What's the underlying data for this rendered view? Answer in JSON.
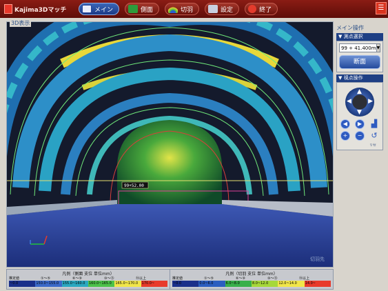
{
  "app": {
    "brand": "Kajima3Dマッチ",
    "brand_icon": "kajima-logo-icon",
    "accent_color": "#7a1610",
    "active_color": "#2a56a8"
  },
  "nav": {
    "main_label": "メイン",
    "side_label": "側面",
    "face_label": "切羽",
    "settings_label": "設定",
    "exit_label": "終了"
  },
  "view": {
    "caption": "3D表示",
    "station_tag": "99+52.00",
    "site_mark": "切羽先"
  },
  "side_panel": {
    "caption": "メイン操作",
    "section_select_title": "▼ 測点選択",
    "station_value": "99 + 41.400m",
    "cut_button_label": "断面",
    "section_view_title": "▼ 視点操作",
    "reset_label": "リセ"
  },
  "legend": {
    "side_title": "凡例（側面 支位 単位mm）",
    "side_heads": [
      "推定値",
      "①〜⑤",
      "⑥〜⑨",
      "⑩〜⑬",
      "⑭以上"
    ],
    "side_ranges": [
      {
        "text": "~0.0",
        "color": "#1a2f8a"
      },
      {
        "text": "150.0~155.0",
        "color": "#3b69c9"
      },
      {
        "text": "155.0~160.0",
        "color": "#2aa8c0"
      },
      {
        "text": "160.0~165.0",
        "color": "#4cc24a"
      },
      {
        "text": "165.0~170.0",
        "color": "#f1e64a"
      },
      {
        "text": "170.0~",
        "color": "#e83a2b"
      }
    ],
    "face_title": "凡例（切羽 支位 単位mm）",
    "face_heads": [
      "推定値",
      "①〜⑤",
      "⑥〜⑨",
      "⑩〜⑬",
      "⑭以上"
    ],
    "face_ranges": [
      {
        "text": "~0.0",
        "color": "#1a2f8a"
      },
      {
        "text": "0.0~6.0",
        "color": "#2b5ec0"
      },
      {
        "text": "6.0~8.0",
        "color": "#38b04a"
      },
      {
        "text": "8.0~12.0",
        "color": "#a6d83a"
      },
      {
        "text": "12.0~14.0",
        "color": "#f1e64a"
      },
      {
        "text": "14.0~",
        "color": "#e83a2b"
      }
    ]
  }
}
